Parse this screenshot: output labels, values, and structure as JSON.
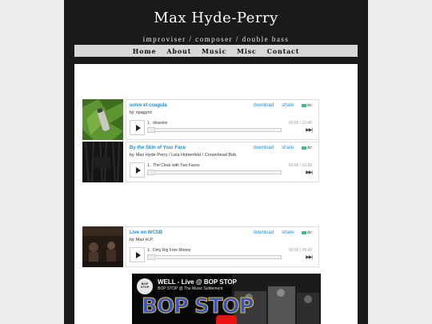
{
  "site": {
    "title": "Max Hyde-Perry",
    "tagline": "improviser / composer / double bass"
  },
  "nav": [
    "Home",
    "About",
    "Music",
    "Misc",
    "Contact"
  ],
  "players": [
    {
      "title": "solve et coagula",
      "by": "by",
      "artist": "spagyric",
      "download": "download",
      "share": "share",
      "bandcamp": "bc",
      "track_num": "1.",
      "track_name": "dissolve",
      "time": "00:00 / 12:46"
    },
    {
      "title": "By the Skin of Your Face",
      "by": "by",
      "artist": "Max Hyde-Perry / Leia Hohenfeld / Crownhead Bob",
      "download": "download",
      "share": "share",
      "bandcamp": "bc",
      "track_num": "1.",
      "track_name": "The Clock with Two Faces",
      "time": "00:00 / 10:28"
    },
    {
      "title": "Live on WCSB",
      "by": "by",
      "artist": "Max H.P.",
      "download": "download",
      "share": "share",
      "bandcamp": "bc",
      "track_num": "1.",
      "track_name": "Dirty Rig Free Money",
      "time": "00:00 / 09:43"
    }
  ],
  "video": {
    "title": "WELL - Live @ BOP STOP",
    "subtitle": "BOP STOP @ The Music Settlement",
    "logo_text": "BOP STOP",
    "big_text": "BOP STOP"
  },
  "colors": {
    "page_bg": "#ececec",
    "header_bg": "#1a1a1a",
    "nav_bg": "#d8d8d8",
    "link": "#1a8fd6",
    "video_play": "#ee1111"
  },
  "icons": [
    "play-icon",
    "next-track-icon",
    "bandcamp-logo-icon",
    "youtube-play-icon"
  ]
}
